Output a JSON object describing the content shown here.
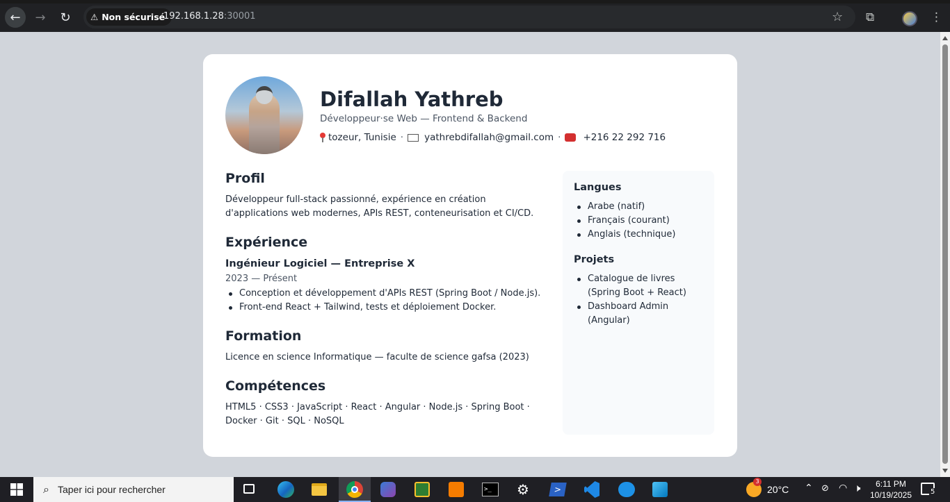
{
  "browser": {
    "security_label": "Non sécurisé",
    "url_host": "192.168.1.28",
    "url_port": ":30001"
  },
  "cv": {
    "name": "Difallah Yathreb",
    "role": "Développeur·se Web — Frontend & Backend",
    "location": "tozeur, Tunisie",
    "email": "yathrebdifallah@gmail.com",
    "phone": "+216 22 292 716",
    "profile": {
      "title": "Profil",
      "text": "Développeur full-stack passionné, expérience en création d'applications web modernes, APIs REST, conteneurisation et CI/CD."
    },
    "experience": {
      "title": "Expérience",
      "job_title": "Ingénieur Logiciel — Entreprise X",
      "job_date": "2023 — Présent",
      "bullets": [
        "Conception et développement d'APIs REST (Spring Boot / Node.js).",
        "Front-end React + Tailwind, tests et déploiement Docker."
      ]
    },
    "education": {
      "title": "Formation",
      "text": "Licence en science Informatique — faculte de science gafsa (2023)"
    },
    "skills": {
      "title": "Compétences",
      "text": "HTML5 · CSS3 · JavaScript · React · Angular · Node.js · Spring Boot · Docker · Git · SQL · NoSQL"
    },
    "languages": {
      "title": "Langues",
      "items": [
        "Arabe (natif)",
        "Français (courant)",
        "Anglais (technique)"
      ]
    },
    "projects": {
      "title": "Projets",
      "items": [
        "Catalogue de livres (Spring Boot + React)",
        "Dashboard Admin (Angular)"
      ]
    }
  },
  "taskbar": {
    "search_placeholder": "Taper ici pour rechercher",
    "weather_temp": "20°C",
    "weather_badge": "3",
    "time": "6:11 PM",
    "date": "10/19/2025",
    "notification_count": "5"
  }
}
